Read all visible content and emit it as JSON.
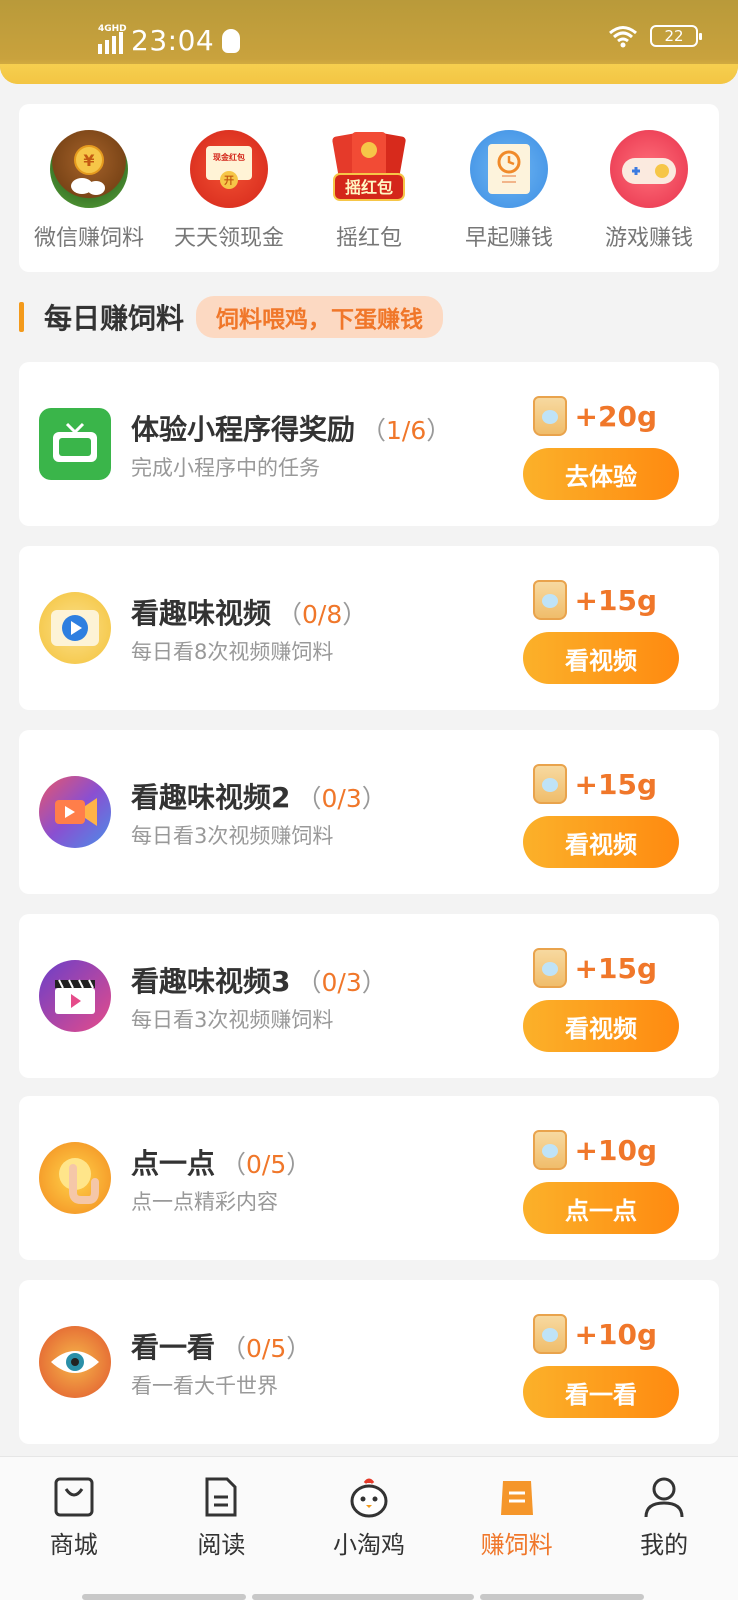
{
  "status_bar": {
    "network": "4GHD",
    "time": "23:04",
    "battery": "22"
  },
  "quick_actions": [
    {
      "label": "微信赚饲料",
      "icon": "wechat-coin-icon"
    },
    {
      "label": "天天领现金",
      "icon": "cash-redpacket-icon"
    },
    {
      "label": "摇红包",
      "icon": "shake-redpacket-icon"
    },
    {
      "label": "早起赚钱",
      "icon": "clock-location-icon"
    },
    {
      "label": "游戏赚钱",
      "icon": "game-controller-icon"
    }
  ],
  "quick_icon_texts": {
    "cash_top": "现金红包",
    "cash_open": "开",
    "redpack_text": "摇红包",
    "coin": "¥"
  },
  "section": {
    "title": "每日赚饲料",
    "tag": "饲料喂鸡，下蛋赚钱"
  },
  "tasks": [
    {
      "title": "体验小程序得奖励",
      "progress": "1/6",
      "subtitle": "完成小程序中的任务",
      "reward": "+20g",
      "button": "去体验",
      "icon": "tv-icon"
    },
    {
      "title": "看趣味视频",
      "progress": "0/8",
      "subtitle": "每日看8次视频赚饲料",
      "reward": "+15g",
      "button": "看视频",
      "icon": "video-play-icon"
    },
    {
      "title": "看趣味视频2",
      "progress": "0/3",
      "subtitle": "每日看3次视频赚饲料",
      "reward": "+15g",
      "button": "看视频",
      "icon": "video-camera-icon"
    },
    {
      "title": "看趣味视频3",
      "progress": "0/3",
      "subtitle": "每日看3次视频赚饲料",
      "reward": "+15g",
      "button": "看视频",
      "icon": "clapperboard-icon"
    },
    {
      "title": "点一点",
      "progress": "0/5",
      "subtitle": "点一点精彩内容",
      "reward": "+10g",
      "button": "点一点",
      "icon": "tap-finger-icon"
    },
    {
      "title": "看一看",
      "progress": "0/5",
      "subtitle": "看一看大千世界",
      "reward": "+10g",
      "button": "看一看",
      "icon": "eye-icon"
    }
  ],
  "paren_open": "（",
  "paren_close": "）",
  "bottom_nav": [
    {
      "label": "商城",
      "icon": "shopping-bag-icon",
      "active": false
    },
    {
      "label": "阅读",
      "icon": "document-icon",
      "active": false
    },
    {
      "label": "小淘鸡",
      "icon": "chicken-icon",
      "active": false
    },
    {
      "label": "赚饲料",
      "icon": "feed-bag-icon",
      "active": true
    },
    {
      "label": "我的",
      "icon": "user-icon",
      "active": false
    }
  ],
  "colors": {
    "accent": "#f0772a",
    "button_start": "#fbb12a",
    "button_end": "#ff8a10",
    "tag_bg": "#fcd9c2"
  }
}
